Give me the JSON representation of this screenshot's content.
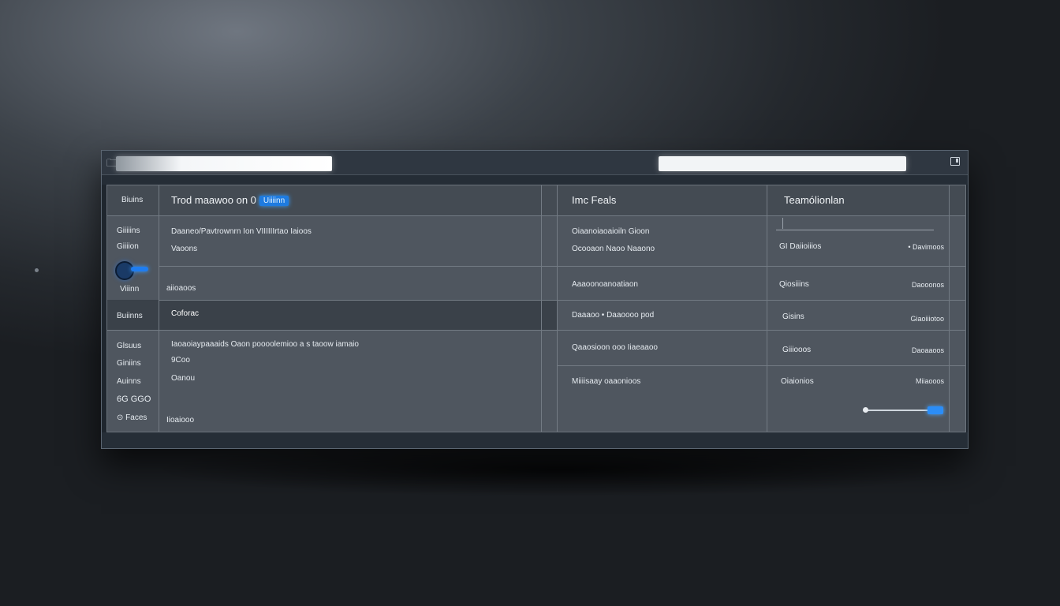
{
  "window": {
    "app_icon": "🗀",
    "address_left": "",
    "address_right": ""
  },
  "sidebar": {
    "header": "Biuins",
    "items": [
      "Giiiiins",
      "Giiiion",
      "Viiinn",
      "Buiinns",
      "Glsuus",
      "Giniins",
      "Auinns",
      "6G GGO",
      "⊙ Faces"
    ]
  },
  "main_panel": {
    "header": "Trod maawoo on 0",
    "header_badge": "Uiiiinn",
    "row1_line1": "Daaneo/Pavtrownrn Ion VIIIIIIrtao Iaioos",
    "row1_line2": "Vaoons",
    "row2": "aiioaoos",
    "row3_selected": "Coforac",
    "row4_line1": "Iaoaoiaypaaaids Oaon poooolemioo a s taoow iamaio",
    "row4_line2": "9Coo",
    "row4_line3": "Oanou",
    "row5": "Iioaiooo"
  },
  "features_panel": {
    "header": "Imc Feals",
    "rows": [
      {
        "line1": "Oiaanoiaoaioiln Gioon",
        "line2": "Ocooaon    Naoo Naaono"
      },
      {
        "line1": "Aaaoonoanoatiaon"
      },
      {
        "line1": "Daaaoo  •  Daaoooo pod"
      },
      {
        "line1": "Qaaosioon    ooo  Iiaeaaoo"
      },
      {
        "line1": "Miiiisaay    oaaonioos"
      }
    ]
  },
  "transactions_panel": {
    "header": "Teamólionlan",
    "rows": [
      {
        "left": "GI Daiioiiios",
        "right": "• Davimoos"
      },
      {
        "left": "Qiosiiins",
        "right": "Daooonos"
      },
      {
        "left": "Gisins",
        "right": "Giaoiiiotoo"
      },
      {
        "left": "Giiiooos",
        "right": "Daoaaoos"
      },
      {
        "left": "Oiaionios",
        "right": "Miiaooos"
      }
    ]
  },
  "colors": {
    "accent": "#1f7df0",
    "panel": "#4f565f",
    "window_frame": "#1f262e"
  }
}
